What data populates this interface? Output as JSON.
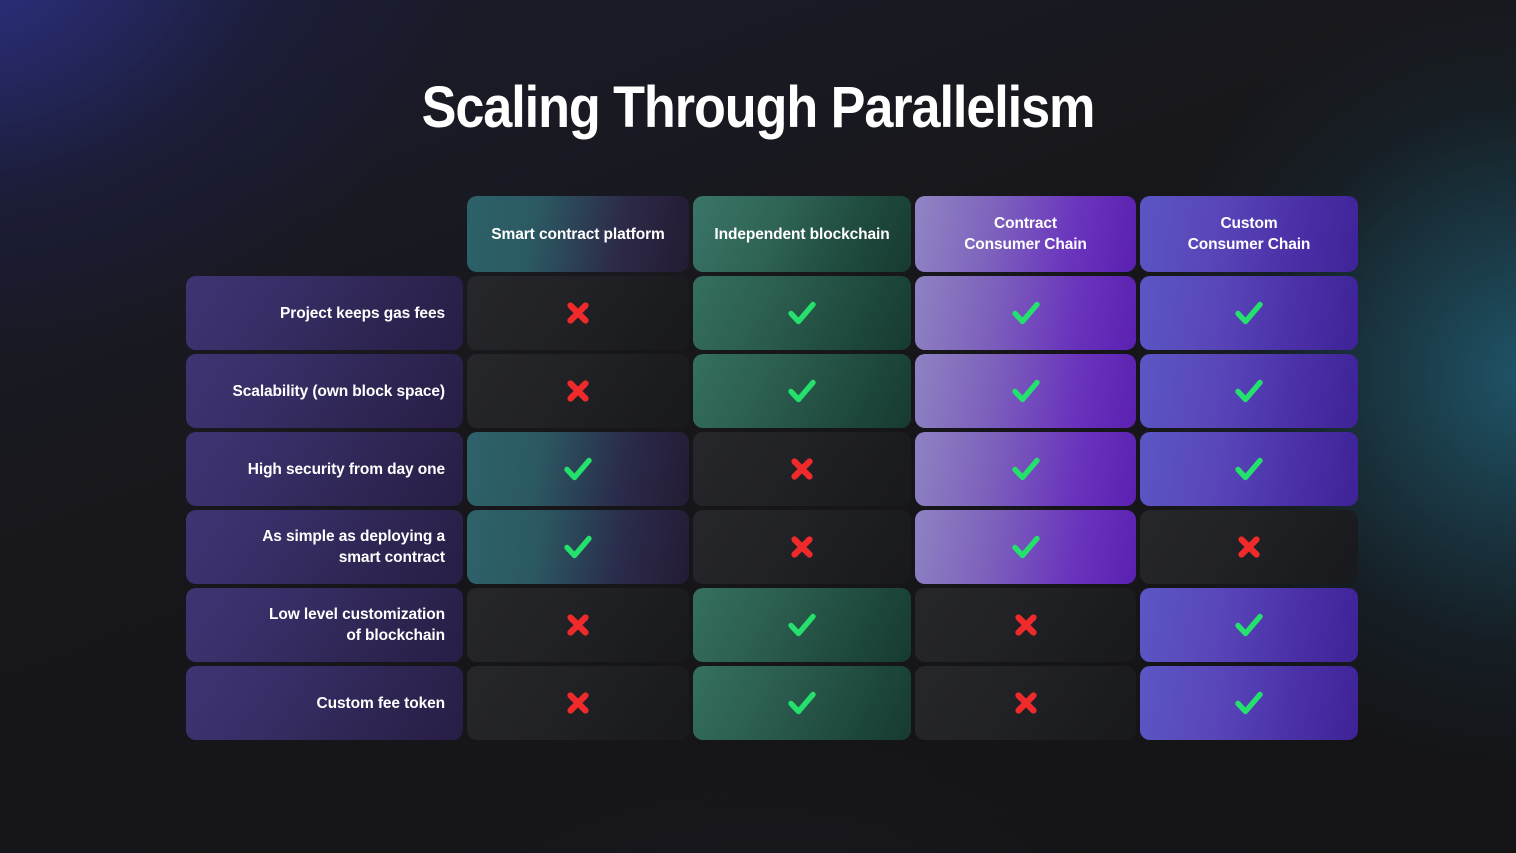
{
  "page": {
    "title": "Scaling Through Parallelism",
    "background_accent_blue": "#2f3390",
    "background_accent_teal": "#1f5568",
    "background_base": "#141417"
  },
  "icons": {
    "check": "check-icon",
    "cross": "cross-icon",
    "check_color": "#24e06c",
    "cross_color": "#f02a2a"
  },
  "matrix": {
    "corner_label": "",
    "columns": [
      {
        "label": "Smart contract platform",
        "lines": [
          "Smart contract platform"
        ],
        "accent": "#2e626a"
      },
      {
        "label": "Independent blockchain",
        "lines": [
          "Independent blockchain"
        ],
        "accent": "#35705f"
      },
      {
        "label": "Contract Consumer Chain",
        "lines": [
          "Contract",
          "Consumer Chain"
        ],
        "accent": "#8f82c2"
      },
      {
        "label": "Custom Consumer Chain",
        "lines": [
          "Custom",
          "Consumer Chain"
        ],
        "accent": "#5b57c5"
      }
    ],
    "rows": [
      {
        "label": "Project keeps gas fees",
        "lines": [
          "Project keeps gas fees"
        ],
        "values": [
          "no",
          "yes",
          "yes",
          "yes"
        ]
      },
      {
        "label": "Scalability (own block space)",
        "lines": [
          "Scalability (own block space)"
        ],
        "values": [
          "no",
          "yes",
          "yes",
          "yes"
        ]
      },
      {
        "label": "High security from day one",
        "lines": [
          "High security from day one"
        ],
        "values": [
          "yes",
          "no",
          "yes",
          "yes"
        ]
      },
      {
        "label": "As simple as deploying a smart contract",
        "lines": [
          "As simple as deploying a",
          "smart contract"
        ],
        "values": [
          "yes",
          "no",
          "yes",
          "no"
        ]
      },
      {
        "label": "Low level customization of blockchain",
        "lines": [
          "Low level customization",
          "of blockchain"
        ],
        "values": [
          "no",
          "yes",
          "no",
          "yes"
        ]
      },
      {
        "label": "Custom fee token",
        "lines": [
          "Custom fee token"
        ],
        "values": [
          "no",
          "yes",
          "no",
          "yes"
        ]
      }
    ]
  }
}
